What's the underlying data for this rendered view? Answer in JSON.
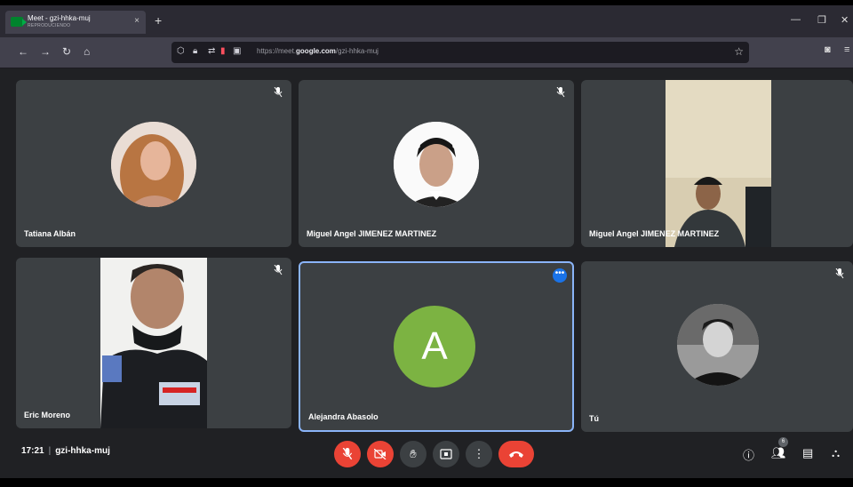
{
  "browser": {
    "tab_title": "Meet - gzi-hhka-muj",
    "tab_subtitle": "REPRODUCIENDO",
    "new_tab": "+",
    "tab_close": "×",
    "url_prefix": "https://meet.",
    "url_domain": "google.com",
    "url_suffix": "/gzi-hhka-muj"
  },
  "participants": [
    {
      "name": "Tatiana Albán"
    },
    {
      "name": "Miguel Angel JIMENEZ MARTINEZ"
    },
    {
      "name": "Miguel Angel JIMENEZ MARTINEZ"
    },
    {
      "name": "Eric Moreno"
    },
    {
      "name": "Alejandra Abasolo",
      "initial": "A",
      "avatar_color": "#7cb342"
    },
    {
      "name": "Tú"
    }
  ],
  "meeting": {
    "time": "17:21",
    "separator": "|",
    "code": "gzi-hhka-muj",
    "participant_count": "6"
  },
  "colors": {
    "accent": "#1a73e8",
    "danger": "#ea4335",
    "tile": "#3c4043",
    "background": "#202124"
  },
  "icons": {
    "mic_off": "mic-off-icon",
    "cam_off": "camera-off-icon",
    "raise_hand": "hand-icon",
    "present": "present-icon",
    "more": "more-vert-icon",
    "end_call": "end-call-icon",
    "info": "info-icon",
    "people": "people-icon",
    "chat": "chat-icon",
    "activities": "activities-icon"
  }
}
